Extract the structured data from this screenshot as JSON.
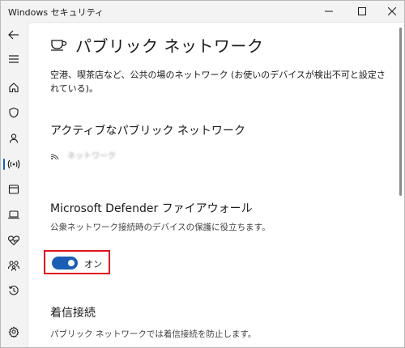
{
  "window": {
    "title": "Windows セキュリティ"
  },
  "sidebar": {
    "items": [
      {
        "name": "back-arrow-icon"
      },
      {
        "name": "hamburger-menu-icon"
      },
      {
        "name": "home-icon"
      },
      {
        "name": "shield-icon"
      },
      {
        "name": "person-icon"
      },
      {
        "name": "wireless-antenna-icon",
        "selected": true
      },
      {
        "name": "app-browser-icon"
      },
      {
        "name": "laptop-icon"
      },
      {
        "name": "heart-pulse-icon"
      },
      {
        "name": "family-icon"
      },
      {
        "name": "history-icon"
      },
      {
        "name": "gear-icon"
      }
    ]
  },
  "page": {
    "title": "パブリック ネットワーク",
    "description": "空港、喫茶店など、公共の場のネットワーク (お使いのデバイスが検出不可と設定されている)。"
  },
  "active_networks": {
    "heading": "アクティブなパブリック ネットワーク",
    "network_name": "ネットワーク"
  },
  "firewall": {
    "heading": "Microsoft Defender ファイアウォール",
    "description": "公衆ネットワーク接続時のデバイスの保護に役立ちます。",
    "toggle_state": "オン",
    "toggle_on": true
  },
  "incoming": {
    "heading": "着信接続",
    "description": "パブリック ネットワークでは着信接続を防止します。"
  },
  "colors": {
    "accent": "#1a5fb4",
    "highlight": "#e0141e"
  }
}
